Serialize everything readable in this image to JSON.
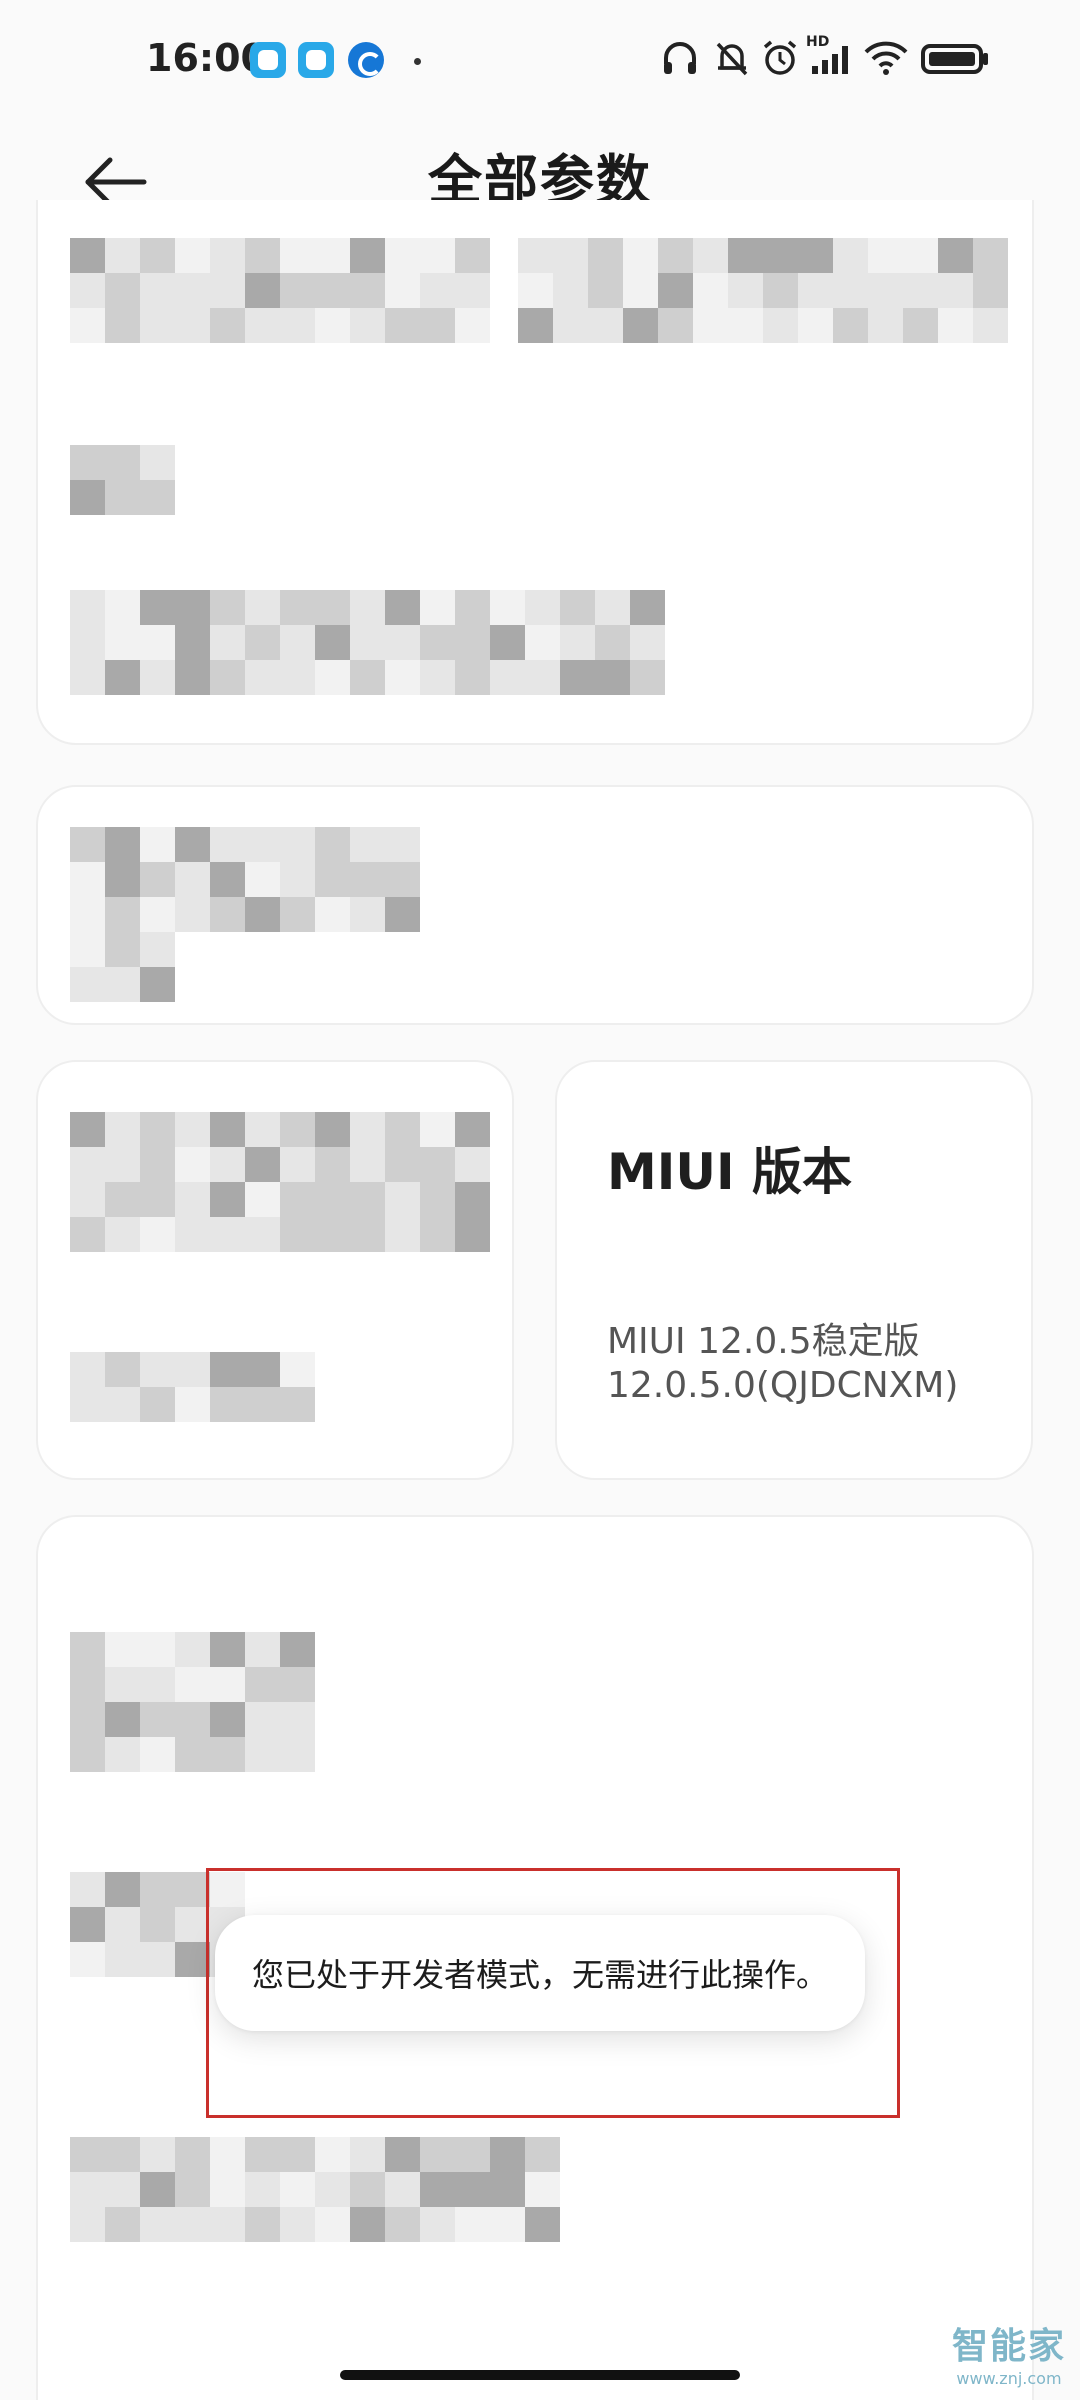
{
  "status_bar": {
    "time": "16:00",
    "network_badge": "HD",
    "icons": [
      "app-notification-icon",
      "app-notification-icon",
      "app-c-icon",
      "headphones-icon",
      "bell-muted-icon",
      "alarm-icon",
      "signal-icon",
      "wifi-icon",
      "battery-icon"
    ]
  },
  "header": {
    "back_icon": "arrow-left-icon",
    "title": "全部参数"
  },
  "miui_card": {
    "title": "MIUI 版本",
    "version_line": "MIUI 12.0.5稳定版",
    "build_line": "12.0.5.0(QJDCNXM)"
  },
  "toast": {
    "message": "您已处于开发者模式，无需进行此操作。"
  },
  "watermark": {
    "logo": "智能家",
    "url": "www.znj.com"
  },
  "colors": {
    "background": "#fafafa",
    "card": "#ffffff",
    "highlight_outline": "#c9302c",
    "pixel_dark": "#a9a9a9",
    "pixel_mid": "#cfcfcf",
    "pixel_light": "#e6e6e6"
  }
}
